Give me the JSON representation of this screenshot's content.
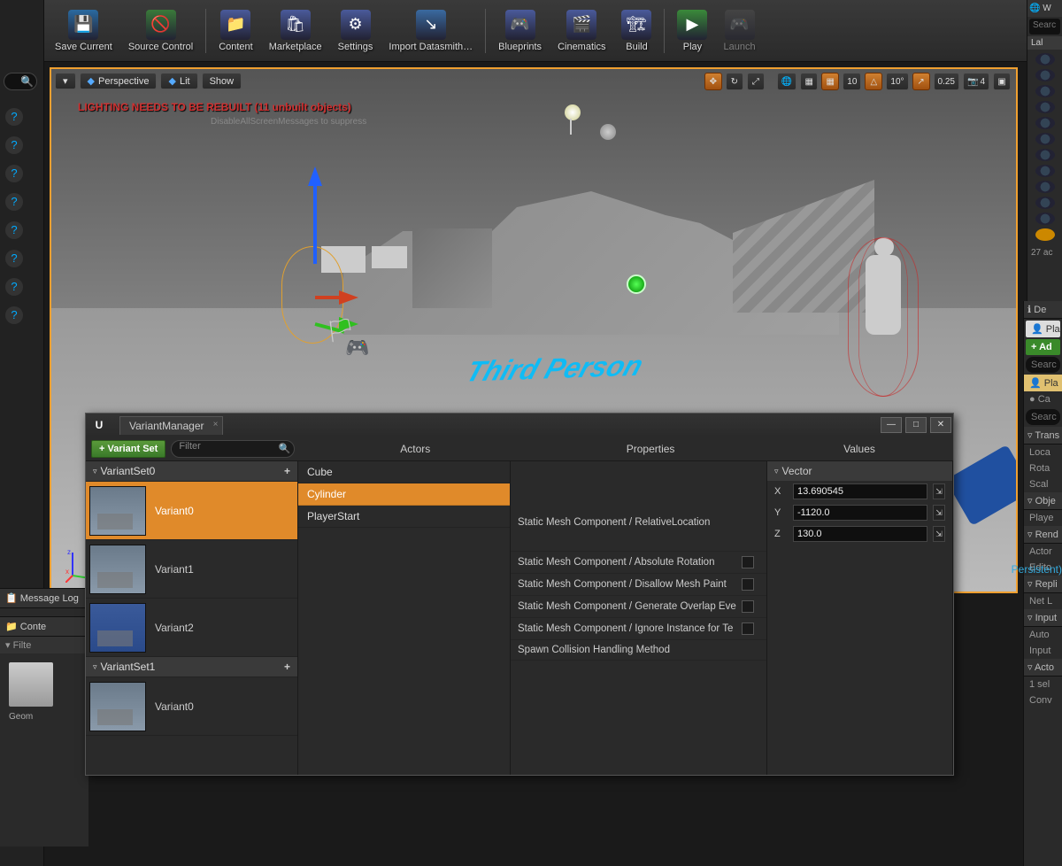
{
  "toolbar": [
    {
      "label": "Save Current",
      "icon": "💾",
      "color": "#2a6aa0"
    },
    {
      "label": "Source Control",
      "icon": "🚫",
      "color": "#3a7a3a"
    },
    {
      "label": "Content",
      "icon": "📁",
      "color": "#4a5a9a"
    },
    {
      "label": "Marketplace",
      "icon": "🛍",
      "color": "#4a5a9a"
    },
    {
      "label": "Settings",
      "icon": "⚙",
      "color": "#4a5a9a"
    },
    {
      "label": "Import Datasmith…",
      "icon": "↘",
      "color": "#3a6aa0"
    },
    {
      "label": "Blueprints",
      "icon": "🎮",
      "color": "#4a5a9a"
    },
    {
      "label": "Cinematics",
      "icon": "🎬",
      "color": "#4a5a9a"
    },
    {
      "label": "Build",
      "icon": "🏗",
      "color": "#4a5a9a"
    },
    {
      "label": "Play",
      "icon": "▶",
      "color": "#3a8a3a"
    },
    {
      "label": "Launch",
      "icon": "🎮",
      "color": "#555",
      "dim": true
    }
  ],
  "viewport": {
    "dropdown": "▾",
    "perspective": "Perspective",
    "lit": "Lit",
    "show": "Show",
    "warning": "LIGHTING NEEDS TO BE REBUILT (11 unbuilt objects)",
    "warning2": "DisableAllScreenMessages to suppress",
    "floor_text": "Third Person",
    "snap_pos": "10",
    "snap_rot": "10°",
    "snap_scale": "0.25",
    "cam_speed": "4"
  },
  "outliner": {
    "count_label": "27 ac",
    "label_header": "Lal"
  },
  "message_log": "Message Log",
  "content_browser": {
    "title": "Conte",
    "filters": "Filte",
    "folder": "Geom"
  },
  "variant_manager": {
    "tab": "VariantManager",
    "add_btn": "+ Variant Set",
    "filter_placeholder": "Filter",
    "col_actors": "Actors",
    "col_props": "Properties",
    "col_values": "Values",
    "sets": [
      {
        "name": "VariantSet0",
        "variants": [
          "Variant0",
          "Variant1",
          "Variant2"
        ],
        "selected": 0
      },
      {
        "name": "VariantSet1",
        "variants": [
          "Variant0"
        ]
      }
    ],
    "actors": [
      "Cube",
      "Cylinder",
      "PlayerStart"
    ],
    "actor_selected": 1,
    "properties": [
      "Static Mesh Component  /  RelativeLocation",
      "Static Mesh Component  /  Absolute Rotation",
      "Static Mesh Component  /  Disallow Mesh Paint",
      "Static Mesh Component  /  Generate Overlap Eve",
      "Static Mesh Component  /  Ignore Instance for Te",
      "Spawn Collision Handling Method"
    ],
    "vector_label": "Vector",
    "vector": {
      "X": "13.690545",
      "Y": "-1120.0",
      "Z": "130.0"
    }
  },
  "details": {
    "tab_player": "Pla",
    "add": "+ Ad",
    "search": "Searc",
    "comp": "Pla",
    "cam": "Ca",
    "sections": [
      {
        "h": "Trans",
        "rows": [
          "Loca",
          "Rota",
          "Scal"
        ]
      },
      {
        "h": "Obje",
        "rows": [
          "Playe"
        ]
      },
      {
        "h": "Rend",
        "rows": [
          "Actor",
          "Edito"
        ]
      },
      {
        "h": "Repli",
        "rows": [
          "Net L"
        ]
      },
      {
        "h": "Input",
        "rows": [
          "Auto",
          "Input"
        ]
      },
      {
        "h": "Acto",
        "rows": [
          "1 sel",
          "Conv"
        ]
      }
    ],
    "persistent": "Persistent)"
  },
  "right_top": {
    "world": "W",
    "search": "Searc",
    "details": "De"
  }
}
